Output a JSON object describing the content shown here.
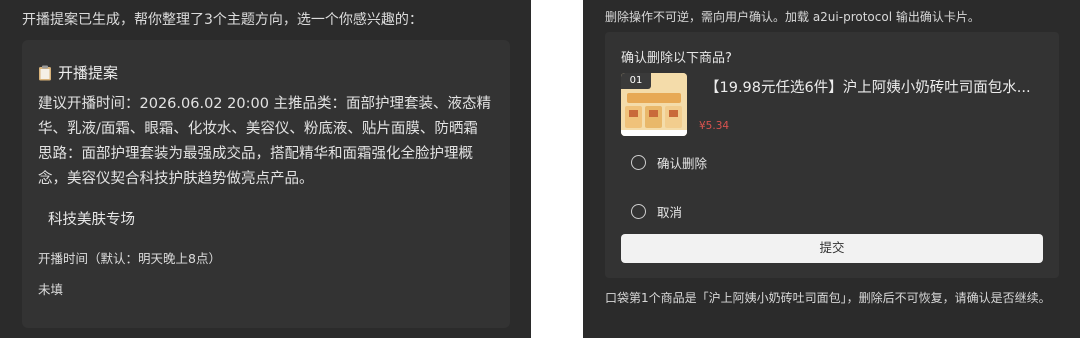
{
  "left": {
    "intro": "开播提案已生成，帮你整理了3个主题方向，选一个你感兴趣的：",
    "plan_title": "开播提案",
    "plan_line1": "建议开播时间：2026.06.02 20:00 主推品类：面部护理套装、液态精",
    "plan_line2": "华、乳液/面霜、眼霜、化妆水、美容仪、粉底液、贴片面膜、防晒霜",
    "plan_line3": "思路：面部护理套装为最强成交品，搭配精华和面霜强化全脸护理概",
    "plan_line4": "念，美容仪契合科技护肤趋势做亮点产品。",
    "topic": "科技美肤专场",
    "field_label": "开播时间（默认：明天晚上8点）",
    "field_value": "未填"
  },
  "right": {
    "intro": "删除操作不可逆，需向用户确认。加载 a2ui-protocol 输出确认卡片。",
    "question": "确认删除以下商品?",
    "product_index": "01",
    "product_name": "【19.98元任选6件】沪上阿姨小奶砖吐司面包水...",
    "product_price": "¥5.34",
    "option_confirm": "确认删除",
    "option_cancel": "取消",
    "submit_label": "提交",
    "note": "口袋第1个商品是「沪上阿姨小奶砖吐司面包」，删除后不可恢复，请确认是否继续。"
  },
  "colors": {
    "panel_bg": "#2b2b2b",
    "card_bg": "#333333",
    "price": "#d9534f",
    "submit_bg": "#f2f2f2"
  },
  "icons": {
    "plan": "clipboard-icon",
    "radio": "radio-empty"
  }
}
